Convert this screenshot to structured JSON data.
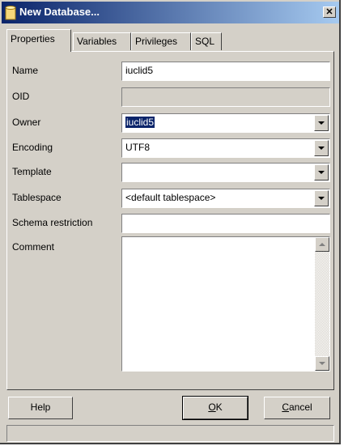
{
  "window": {
    "title": "New Database...",
    "close_glyph": "✕",
    "icon": "database-icon"
  },
  "tabs": [
    {
      "label": "Properties",
      "active": true
    },
    {
      "label": "Variables",
      "active": false
    },
    {
      "label": "Privileges",
      "active": false
    },
    {
      "label": "SQL",
      "active": false
    }
  ],
  "form": {
    "name": {
      "label": "Name",
      "value": "iuclid5"
    },
    "oid": {
      "label": "OID",
      "value": ""
    },
    "owner": {
      "label": "Owner",
      "value": "iuclid5"
    },
    "encoding": {
      "label": "Encoding",
      "value": "UTF8"
    },
    "template": {
      "label": "Template",
      "value": ""
    },
    "tablespace": {
      "label": "Tablespace",
      "value": "<default tablespace>"
    },
    "schema_restriction": {
      "label": "Schema restriction",
      "value": ""
    },
    "comment": {
      "label": "Comment",
      "value": ""
    }
  },
  "buttons": {
    "help": "Help",
    "ok_mnemonic": "O",
    "ok_rest": "K",
    "cancel_mnemonic": "C",
    "cancel_rest": "ancel"
  },
  "colors": {
    "selection": "#0a246a",
    "face": "#d4d0c8",
    "title_start": "#0a246a"
  }
}
